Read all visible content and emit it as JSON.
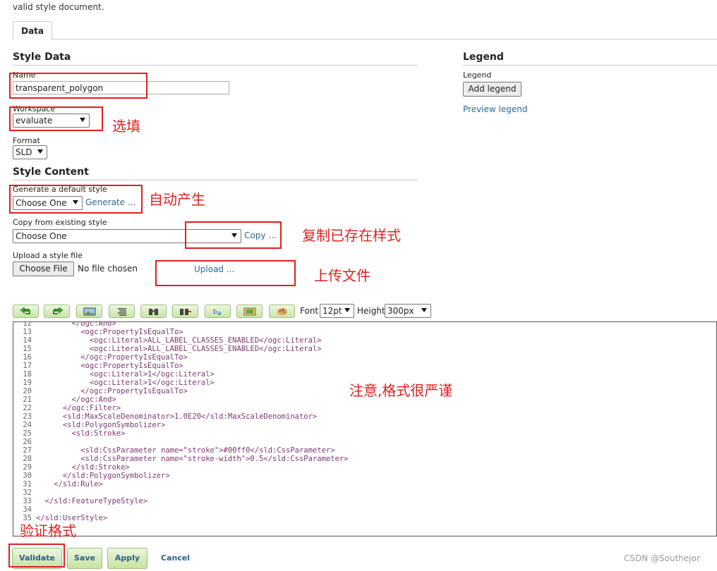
{
  "header": {
    "message": "valid style document."
  },
  "tabs": [
    {
      "label": "Data"
    }
  ],
  "style_data": {
    "title": "Style Data",
    "name_label": "Name",
    "name_value": "transparent_polygon",
    "workspace_label": "Workspace",
    "workspace_value": "evaluate",
    "format_label": "Format",
    "format_value": "SLD"
  },
  "style_content": {
    "title": "Style Content",
    "generate_label": "Generate a default style",
    "generate_select": "Choose One",
    "generate_link": "Generate ...",
    "copy_label": "Copy from existing style",
    "copy_select": "Choose One",
    "copy_link": "Copy ...",
    "upload_label": "Upload a style file",
    "choose_file": "Choose File",
    "no_file": "No file chosen",
    "upload_link": "Upload ..."
  },
  "legend": {
    "title": "Legend",
    "label": "Legend",
    "add_button": "Add legend",
    "preview_link": "Preview legend"
  },
  "toolbar": {
    "font_label": "Font",
    "font_value": "12pt",
    "height_label": "Height",
    "height_value": "300px",
    "icons": [
      "undo-icon",
      "redo-icon",
      "image-icon",
      "format-icon",
      "find-icon",
      "replace-icon",
      "text-icon",
      "preview-icon",
      "palette-icon"
    ]
  },
  "editor": {
    "lines": [
      {
        "n": "12",
        "t": "        </ogc:And>"
      },
      {
        "n": "13",
        "t": "          <ogc:PropertyIsEqualTo>"
      },
      {
        "n": "14",
        "t": "            <ogc:Literal>ALL_LABEL_CLASSES_ENABLED</ogc:Literal>"
      },
      {
        "n": "15",
        "t": "            <ogc:Literal>ALL_LABEL_CLASSES_ENABLED</ogc:Literal>"
      },
      {
        "n": "16",
        "t": "          </ogc:PropertyIsEqualTo>"
      },
      {
        "n": "17",
        "t": "          <ogc:PropertyIsEqualTo>"
      },
      {
        "n": "18",
        "t": "            <ogc:Literal>1</ogc:Literal>"
      },
      {
        "n": "19",
        "t": "            <ogc:Literal>1</ogc:Literal>"
      },
      {
        "n": "20",
        "t": "          </ogc:PropertyIsEqualTo>"
      },
      {
        "n": "21",
        "t": "        </ogc:And>"
      },
      {
        "n": "22",
        "t": "      </ogc:Filter>"
      },
      {
        "n": "23",
        "t": "      <sld:MaxScaleDenominator>1.0E20</sld:MaxScaleDenominator>"
      },
      {
        "n": "24",
        "t": "      <sld:PolygonSymbolizer>"
      },
      {
        "n": "25",
        "t": "        <sld:Stroke>"
      },
      {
        "n": "26",
        "t": ""
      },
      {
        "n": "27",
        "t": "          <sld:CssParameter name=\"stroke\">#00ff0</sld:CssParameter>"
      },
      {
        "n": "28",
        "t": "          <sld:CssParameter name=\"stroke-width\">0.5</sld:CssParameter>"
      },
      {
        "n": "29",
        "t": "        </sld:Stroke>"
      },
      {
        "n": "30",
        "t": "      </sld:PolygonSymbolizer>"
      },
      {
        "n": "31",
        "t": "    </sld:Rule>"
      },
      {
        "n": "32",
        "t": ""
      },
      {
        "n": "33",
        "t": "  </sld:FeatureTypeStyle>"
      },
      {
        "n": "34",
        "t": ""
      },
      {
        "n": "35",
        "t": "</sld:UserStyle>"
      }
    ]
  },
  "annotations": {
    "optional": "选填",
    "auto": "自动产生",
    "copy": "复制已存在样式",
    "upload": "上传文件",
    "strict": "注意,格式很严谨",
    "validate": "验证格式"
  },
  "footer": {
    "validate": "Validate",
    "save": "Save",
    "apply": "Apply",
    "cancel": "Cancel"
  },
  "watermark": "CSDN @Southejor"
}
